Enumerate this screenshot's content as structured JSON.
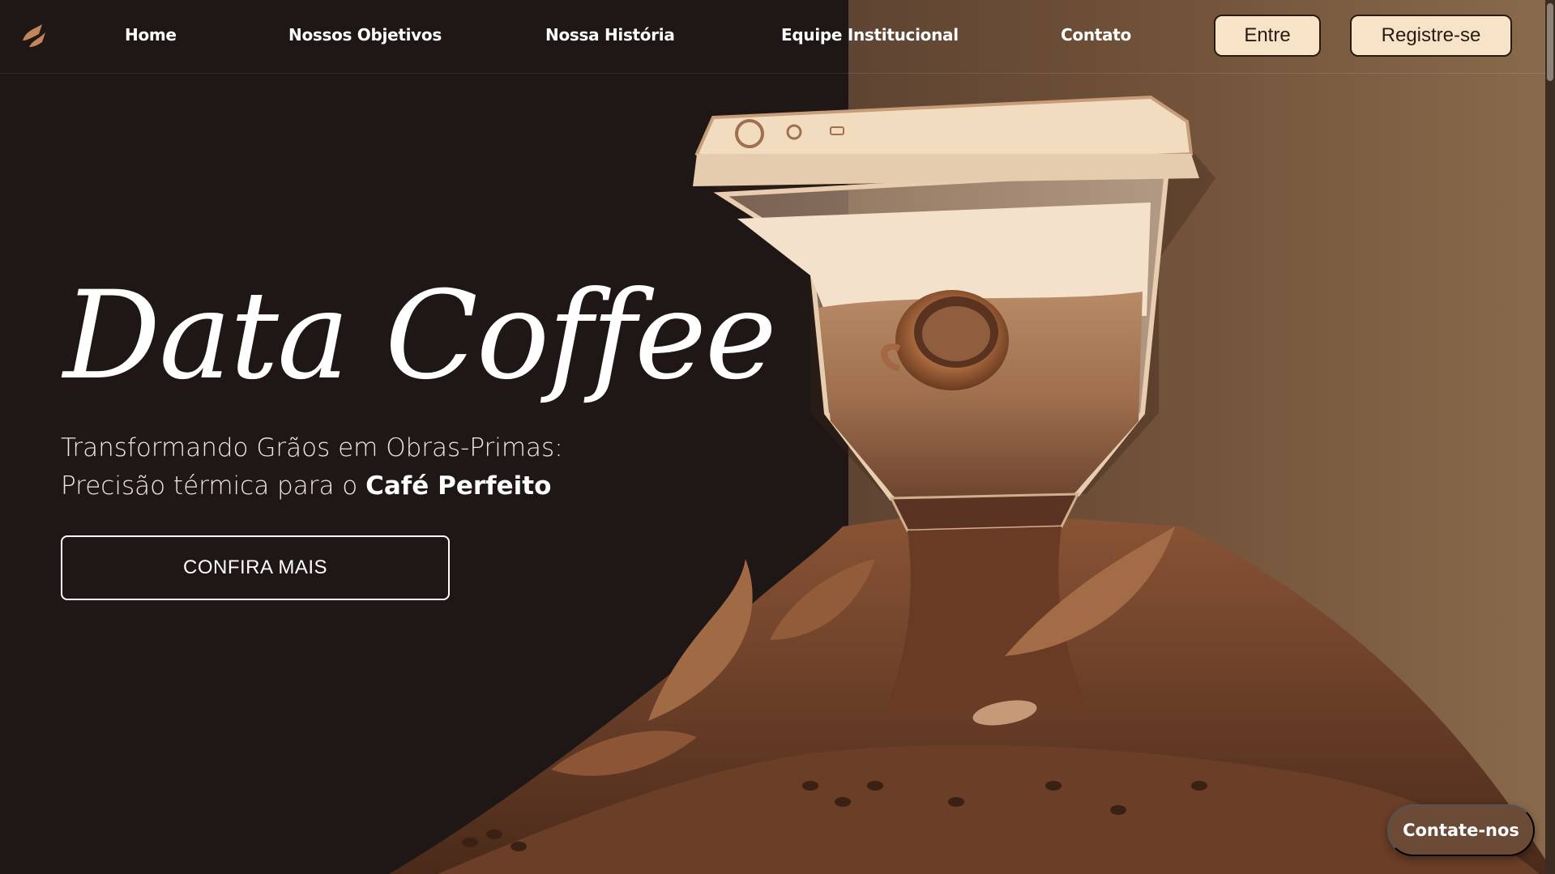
{
  "nav": {
    "links": [
      "Home",
      "Nossos Objetivos",
      "Nossa História",
      "Equipe Institucional",
      "Contato"
    ],
    "login_label": "Entre",
    "register_label": "Registre-se"
  },
  "hero": {
    "title": "Data Coffee",
    "subtitle_line1": "Transformando Grãos em Obras-Primas:",
    "subtitle_line2_prefix": "Precisão térmica para o ",
    "subtitle_line2_bold": "Café Perfeito",
    "cta_label": "CONFIRA MAIS"
  },
  "contact_button": "Contate-nos",
  "icons": {
    "logo": "brand-logo-icon",
    "illustration": "coffee-machine-illustration"
  },
  "colors": {
    "background": "#1f1616",
    "panel": "#6f5038",
    "button_fill": "#f6e3c8",
    "accent": "#c4855a"
  }
}
